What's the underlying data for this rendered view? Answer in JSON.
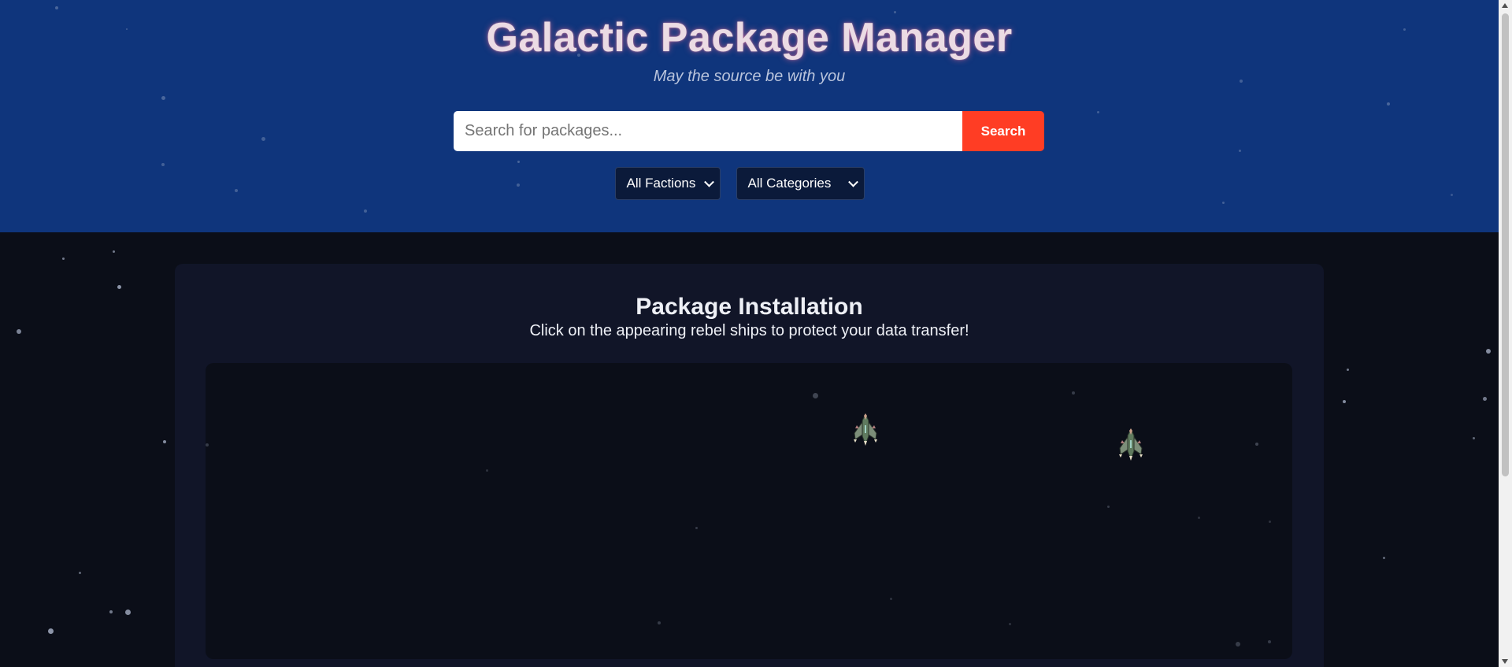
{
  "header": {
    "title": "Galactic Package Manager",
    "tagline": "May the source be with you"
  },
  "search": {
    "placeholder": "Search for packages...",
    "value": "",
    "button_label": "Search"
  },
  "filters": {
    "faction": {
      "selected": "All Factions"
    },
    "category": {
      "selected": "All Categories"
    }
  },
  "installation": {
    "title": "Package Installation",
    "subtitle": "Click on the appearing rebel ships to protect your data transfer!",
    "ships": [
      {
        "name": "rebel-ship-icon"
      },
      {
        "name": "rebel-ship-icon"
      }
    ]
  },
  "colors": {
    "header_bg": "#0f357c",
    "page_bg": "#0b0e18",
    "panel_bg": "#111528",
    "search_button": "#ff3d24",
    "title_text": "#ebdbe4"
  }
}
